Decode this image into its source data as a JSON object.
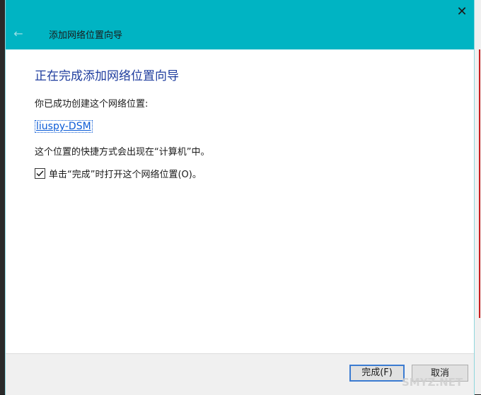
{
  "window": {
    "title": "添加网络位置向导",
    "back_glyph": "←",
    "close_glyph": "✕"
  },
  "content": {
    "heading": "正在完成添加网络位置向导",
    "success_text": "你已成功创建这个网络位置:",
    "location_link": "liuspy-DSM",
    "shortcut_text": "这个位置的快捷方式会出现在“计算机”中。",
    "checkbox": {
      "label": "单击“完成”时打开这个网络位置(O)。",
      "checked": true
    }
  },
  "buttons": {
    "finish": "完成(F)",
    "cancel": "取消"
  },
  "watermark": "SMYZ.NET",
  "colors": {
    "titlebar": "#00b4c3",
    "heading": "#1f3d9e",
    "link": "#0b5bd6"
  }
}
